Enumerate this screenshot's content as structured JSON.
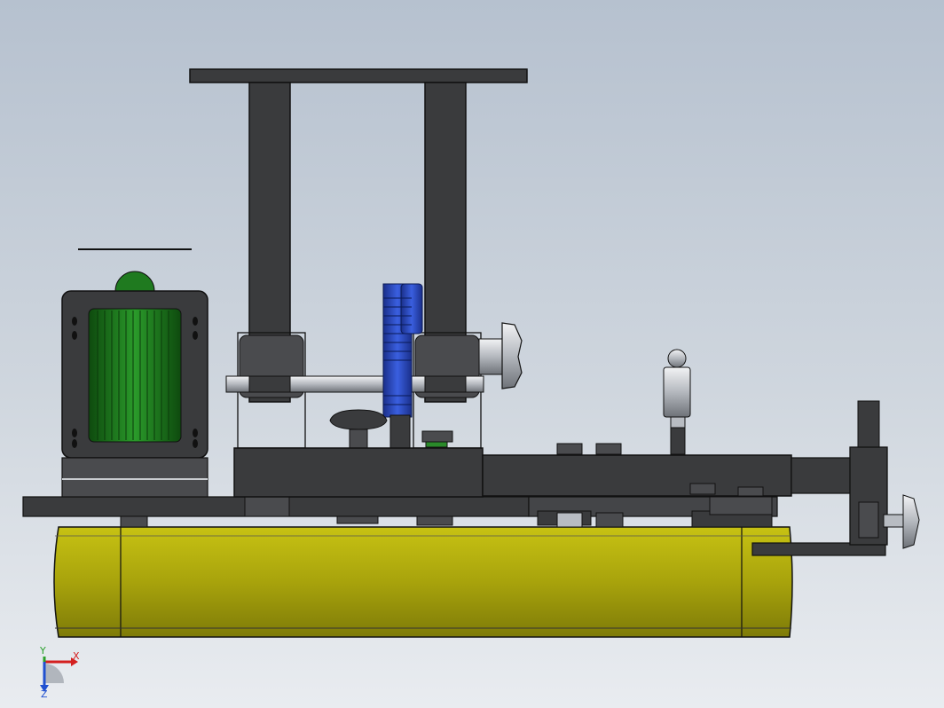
{
  "viewport": {
    "background_top": "#b6c1cf",
    "background_bottom": "#e9ecf0"
  },
  "model": {
    "colors": {
      "frame_dark": "#3a3b3d",
      "frame_mid": "#4a4b4e",
      "edge": "#111111",
      "base_yellow": "#a8a30c",
      "base_yellow_dark": "#8a870a",
      "motor_green": "#1f7a1f",
      "motor_green_dark": "#125412",
      "screw_blue": "#2244bb",
      "steel": "#b8bcc2",
      "steel_light": "#e2e4e8"
    }
  },
  "triad": {
    "x_label": "X",
    "y_label": "Y",
    "z_label": "Z",
    "x_color": "#d42020",
    "y_color": "#2aa02a",
    "z_color": "#2050d0"
  }
}
